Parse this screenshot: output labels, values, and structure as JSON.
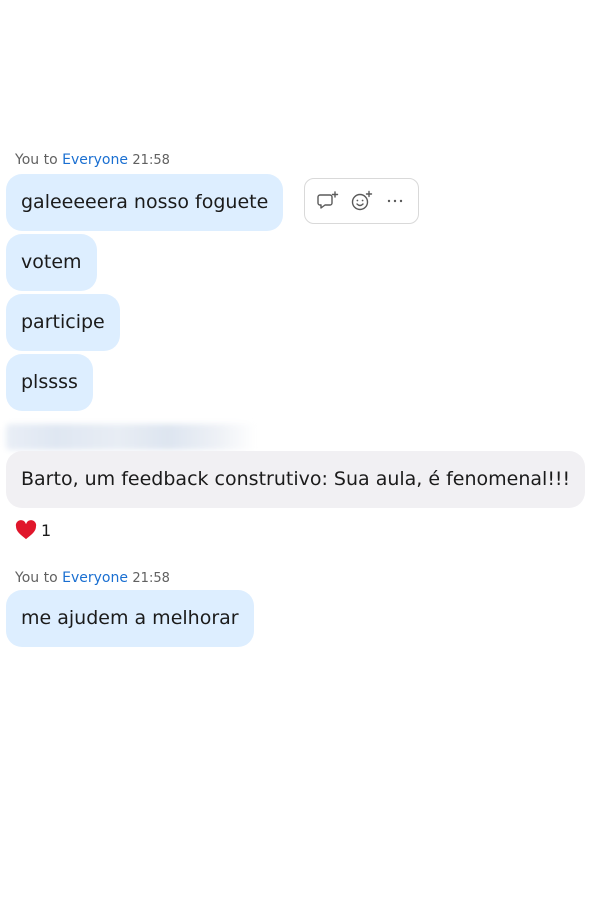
{
  "groups": [
    {
      "sender": "You",
      "to_word": "to",
      "recipient": "Everyone",
      "time": "21:58",
      "messages": [
        "galeeeeera nosso foguete",
        "votem",
        "participe",
        "plssss"
      ]
    },
    {
      "message": "Barto, um feedback construtivo: Sua aula, é fenomenal!!!",
      "reaction": {
        "icon": "heart-icon",
        "count": "1"
      }
    },
    {
      "sender": "You",
      "to_word": "to",
      "recipient": "Everyone",
      "time": "21:58",
      "messages": [
        "me ajudem a melhorar"
      ]
    }
  ],
  "hover_actions": [
    {
      "icon": "reply-thread-icon"
    },
    {
      "icon": "add-reaction-icon"
    },
    {
      "icon": "more-options-icon"
    }
  ],
  "colors": {
    "own_bubble": "#ddeeff",
    "other_bubble": "#f1f0f3",
    "recipient_link": "#1a6fd1",
    "heart": "#e0162b"
  }
}
